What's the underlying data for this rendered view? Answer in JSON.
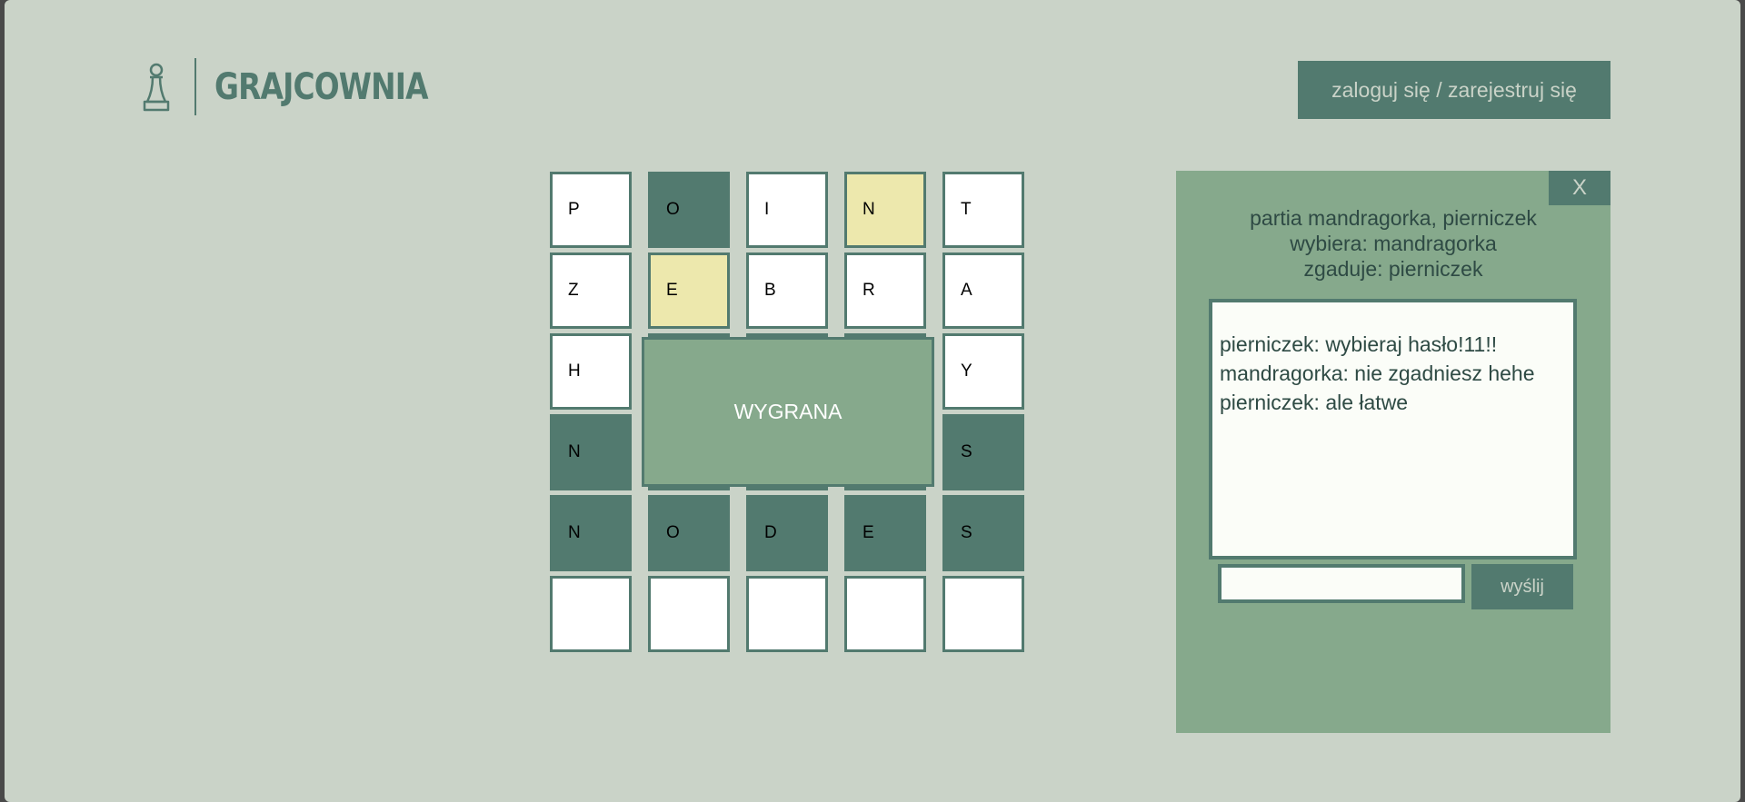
{
  "brand": {
    "name": "GRAJCOWNIA",
    "icon": "pawn-icon"
  },
  "header": {
    "login_label": "zaloguj się / zarejestruj się"
  },
  "board": {
    "rows": [
      [
        {
          "letter": "P",
          "state": "absent"
        },
        {
          "letter": "O",
          "state": "correct"
        },
        {
          "letter": "I",
          "state": "absent"
        },
        {
          "letter": "N",
          "state": "present"
        },
        {
          "letter": "T",
          "state": "absent"
        }
      ],
      [
        {
          "letter": "Z",
          "state": "absent"
        },
        {
          "letter": "E",
          "state": "present"
        },
        {
          "letter": "B",
          "state": "absent"
        },
        {
          "letter": "R",
          "state": "absent"
        },
        {
          "letter": "A",
          "state": "absent"
        }
      ],
      [
        {
          "letter": "H",
          "state": "absent"
        },
        {
          "letter": "",
          "state": "hidden"
        },
        {
          "letter": "",
          "state": "hidden"
        },
        {
          "letter": "",
          "state": "hidden"
        },
        {
          "letter": "Y",
          "state": "absent"
        }
      ],
      [
        {
          "letter": "N",
          "state": "correct"
        },
        {
          "letter": "",
          "state": "hidden"
        },
        {
          "letter": "",
          "state": "hidden"
        },
        {
          "letter": "",
          "state": "hidden"
        },
        {
          "letter": "S",
          "state": "correct"
        }
      ],
      [
        {
          "letter": "N",
          "state": "correct"
        },
        {
          "letter": "O",
          "state": "correct"
        },
        {
          "letter": "D",
          "state": "correct"
        },
        {
          "letter": "E",
          "state": "correct"
        },
        {
          "letter": "S",
          "state": "correct"
        }
      ],
      [
        {
          "letter": "",
          "state": "empty"
        },
        {
          "letter": "",
          "state": "empty"
        },
        {
          "letter": "",
          "state": "empty"
        },
        {
          "letter": "",
          "state": "empty"
        },
        {
          "letter": "",
          "state": "empty"
        }
      ]
    ],
    "result_label": "WYGRANA"
  },
  "chat": {
    "close_label": "X",
    "game_info": [
      "partia mandragorka, pierniczek",
      "wybiera: mandragorka",
      "zgaduje: pierniczek"
    ],
    "messages": [
      "pierniczek: wybieraj hasło!11!!",
      "mandragorka: nie zgadniesz hehe",
      "pierniczek: ale łatwe"
    ],
    "input_value": "",
    "input_placeholder": "",
    "send_label": "wyślij"
  },
  "colors": {
    "background": "#cad3c8",
    "accent": "#527a6f",
    "panel": "#86a98c",
    "present": "#ede8ad"
  }
}
